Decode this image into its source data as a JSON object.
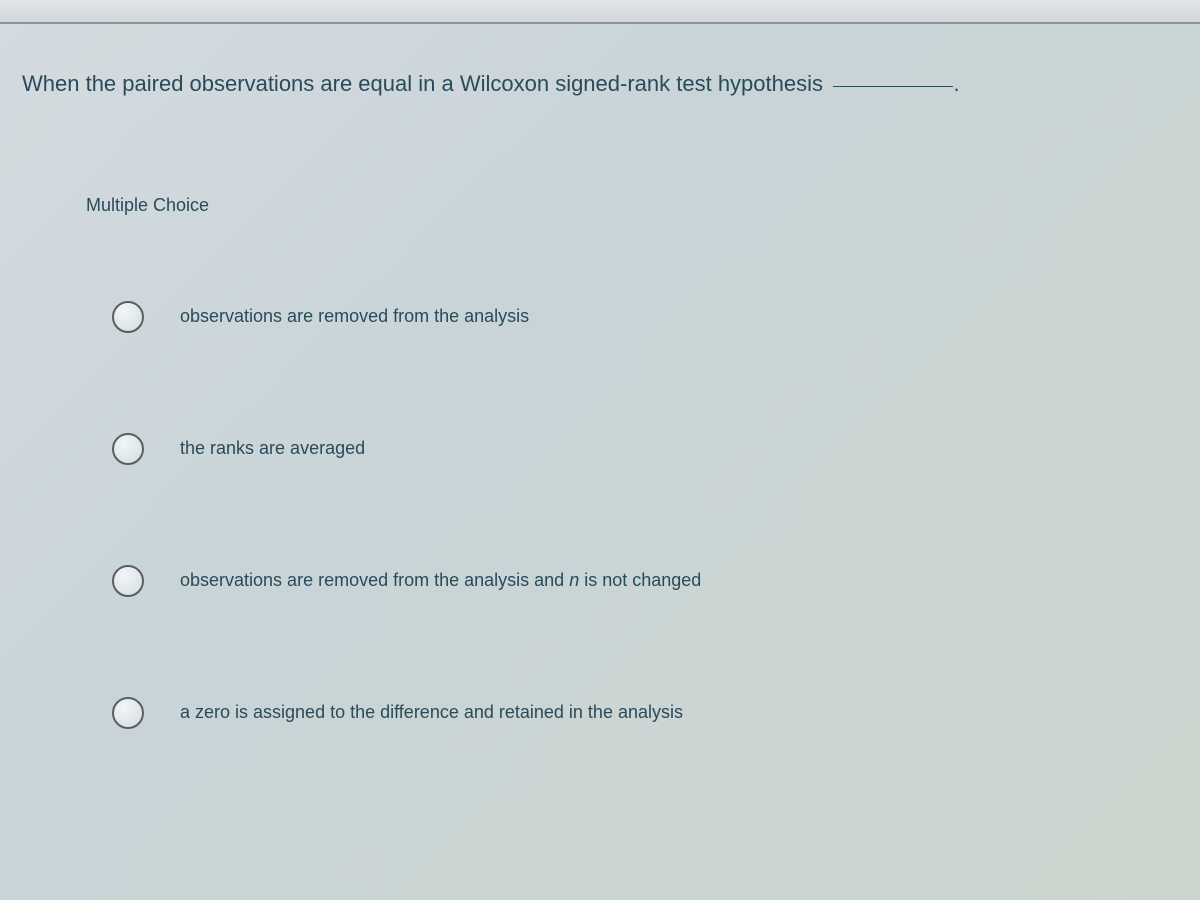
{
  "question": {
    "stem": "When the paired observations are equal in a Wilcoxon signed-rank test hypothesis"
  },
  "section_label": "Multiple Choice",
  "options": [
    {
      "text": "observations are removed from the analysis"
    },
    {
      "text": "the ranks are averaged"
    },
    {
      "text_html": "observations are removed from the analysis and <em>n</em> is not changed"
    },
    {
      "text": "a zero is assigned to the difference and retained in the analysis"
    }
  ]
}
